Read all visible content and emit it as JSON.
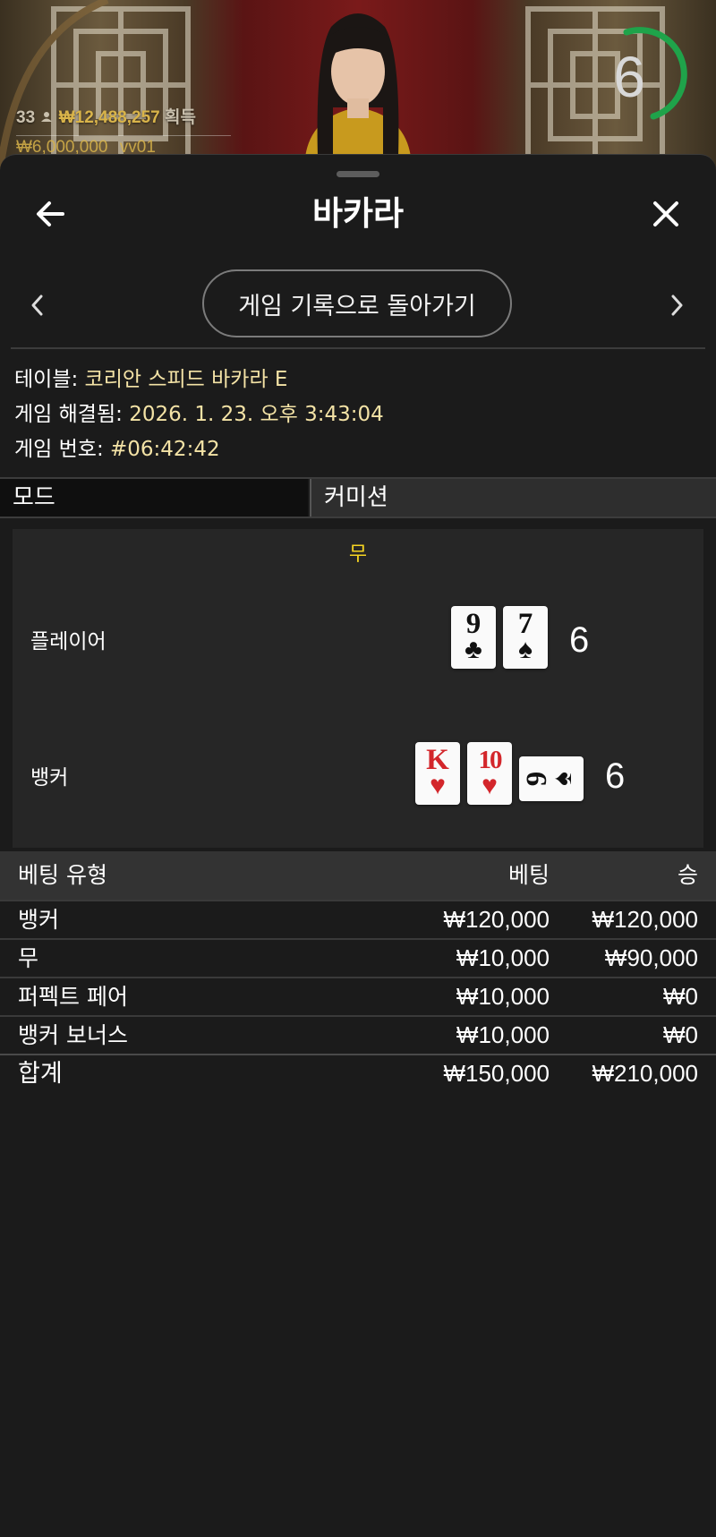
{
  "video": {
    "player_count": "33",
    "total_won": "₩12,488,257",
    "won_label": "획득",
    "bet_limits": "₩6,000,000",
    "table_code": "vv01",
    "timer": "6"
  },
  "header": {
    "title": "바카라"
  },
  "history_button_label": "게임 기록으로 돌아가기",
  "info": {
    "table_label": "테이블:",
    "table_value": "코리안 스피드 바카라 E",
    "resolved_label": "게임 해결됨:",
    "resolved_value": "2026. 1. 23. 오후 3:43:04",
    "game_no_label": "게임 번호:",
    "game_no_value": "#06:42:42"
  },
  "mode": {
    "label": "모드",
    "value": "커미션"
  },
  "result": {
    "outcome": "무",
    "player": {
      "label": "플레이어",
      "score": "6",
      "cards": [
        {
          "rank": "9",
          "suit": "♣",
          "color": "black"
        },
        {
          "rank": "7",
          "suit": "♠",
          "color": "black"
        }
      ]
    },
    "banker": {
      "label": "뱅커",
      "score": "6",
      "cards": [
        {
          "rank": "K",
          "suit": "♥",
          "color": "red"
        },
        {
          "rank": "10",
          "suit": "♥",
          "color": "red"
        },
        {
          "rank": "9",
          "suit": "♠",
          "color": "black",
          "orientation": "sideways"
        }
      ]
    }
  },
  "bets": {
    "headers": {
      "type": "베팅 유형",
      "bet": "베팅",
      "win": "승"
    },
    "rows": [
      {
        "type": "뱅커",
        "bet": "₩120,000",
        "win": "₩120,000"
      },
      {
        "type": "무",
        "bet": "₩10,000",
        "win": "₩90,000"
      },
      {
        "type": "퍼펙트 페어",
        "bet": "₩10,000",
        "win": "₩0"
      },
      {
        "type": "뱅커 보너스",
        "bet": "₩10,000",
        "win": "₩0"
      }
    ],
    "total": {
      "type": "합계",
      "bet": "₩150,000",
      "win": "₩210,000"
    }
  },
  "colors": {
    "background": "#1b1b1b",
    "info_value": "#f4e3a6",
    "outcome": "#f5d422",
    "timer_ring": "#1fa34a",
    "stat_gold": "#d9b44a"
  },
  "icons": {
    "back": "arrow-left-icon",
    "close": "close-icon",
    "prev": "chevron-left-icon",
    "next": "chevron-right-icon",
    "players": "person-icon"
  }
}
